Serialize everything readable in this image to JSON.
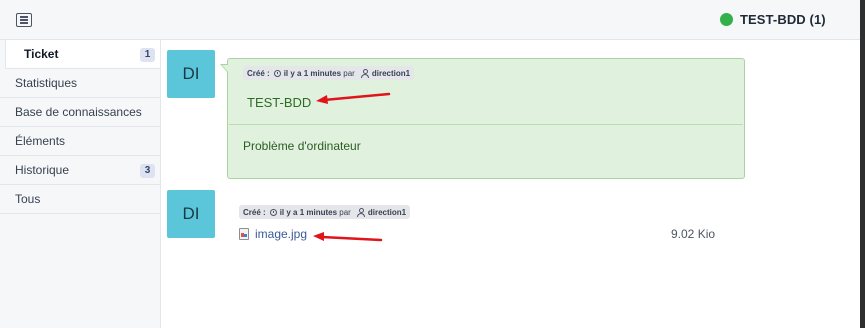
{
  "header": {
    "ticket_title": "TEST-BDD (1)",
    "status_color": "#34b04a",
    "menu_icon": "menu-list-icon"
  },
  "sidebar": {
    "items": [
      {
        "label": "Ticket",
        "badge": "1",
        "active": true
      },
      {
        "label": "Statistiques"
      },
      {
        "label": "Base de connaissances"
      },
      {
        "label": "Éléments"
      },
      {
        "label": "Historique",
        "badge": "3"
      },
      {
        "label": "Tous"
      }
    ]
  },
  "timeline": [
    {
      "avatar": "DI",
      "meta": {
        "created_label": "Créé :",
        "time": "il y a 1 minutes",
        "by": "par",
        "user": "direction1"
      },
      "title": "TEST-BDD",
      "content": "Problème d'ordinateur",
      "bg_color": "#e0f2dd"
    },
    {
      "avatar": "DI",
      "meta": {
        "created_label": "Créé :",
        "time": "il y a 1 minutes",
        "by": "par",
        "user": "direction1"
      },
      "document": {
        "name": "image.jpg",
        "size": "9.02 Kio"
      }
    }
  ],
  "annotation_color": "#e0141b"
}
